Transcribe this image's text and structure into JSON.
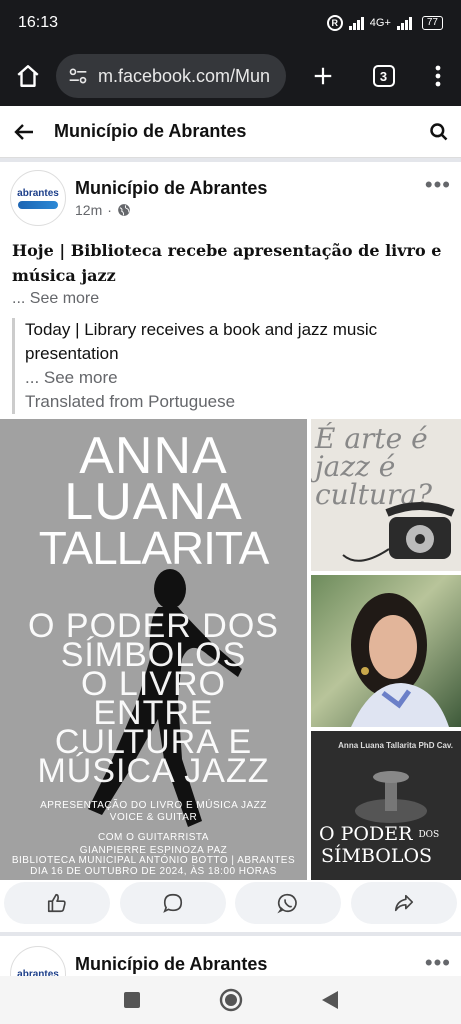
{
  "status": {
    "time": "16:13",
    "r_badge": "R",
    "network": "4G+",
    "battery": "77"
  },
  "browser": {
    "url": "m.facebook.com/Mun",
    "tab_count": "3"
  },
  "page_header": {
    "title": "Município de Abrantes"
  },
  "post": {
    "author": "Município de Abrantes",
    "avatar_text": "abrantes",
    "time": "12m",
    "dot": "·",
    "headline": "Hoje | Biblioteca recebe apresentação de livro e música jazz",
    "see_more": "... See more",
    "translation_text": "Today | Library receives a book and jazz music presentation",
    "translation_see_more": "... See more",
    "translated_from": "Translated from Portuguese",
    "poster": {
      "name_lines": [
        "ANNA",
        "LUANA",
        "TALLARITA"
      ],
      "title_lines": [
        "O PODER DOS",
        "SÍMBOLOS",
        "O LIVRO",
        "ENTRE",
        "CULTURA E",
        "MÚSICA JAZZ"
      ],
      "info_lines": [
        "APRESENTAÇÃO DO LIVRO E MÚSICA JAZZ",
        "VOICE & GUITAR",
        "COM O GUITARRISTA",
        "GIANPIERRE ESPINOZA PAZ",
        "BIBLIOTECA MUNICIPAL ANTÓNIO BOTTO | ABRANTES",
        "DIA 16 DE OUTUBRO DE 2024, ÀS 18:00 HORAS"
      ]
    },
    "thumb1_text": "É arte é jazz é cultura?",
    "thumb3_author": "Anna Luana Tallarita PhD Cav.",
    "thumb3_title_1": "O PODER",
    "thumb3_title_1b": "DOS",
    "thumb3_title_2": "SÍMBOLOS"
  },
  "post2": {
    "author": "Município de Abrantes",
    "avatar_text": "abrantes"
  },
  "icons": [
    "home-icon",
    "site-settings-icon",
    "plus-icon",
    "tabs-icon",
    "menu-icon",
    "back-arrow-icon",
    "search-icon",
    "globe-icon",
    "more-icon",
    "like-icon",
    "comment-icon",
    "whatsapp-icon",
    "share-icon",
    "nav-recents-icon",
    "nav-home-icon",
    "nav-back-icon"
  ]
}
